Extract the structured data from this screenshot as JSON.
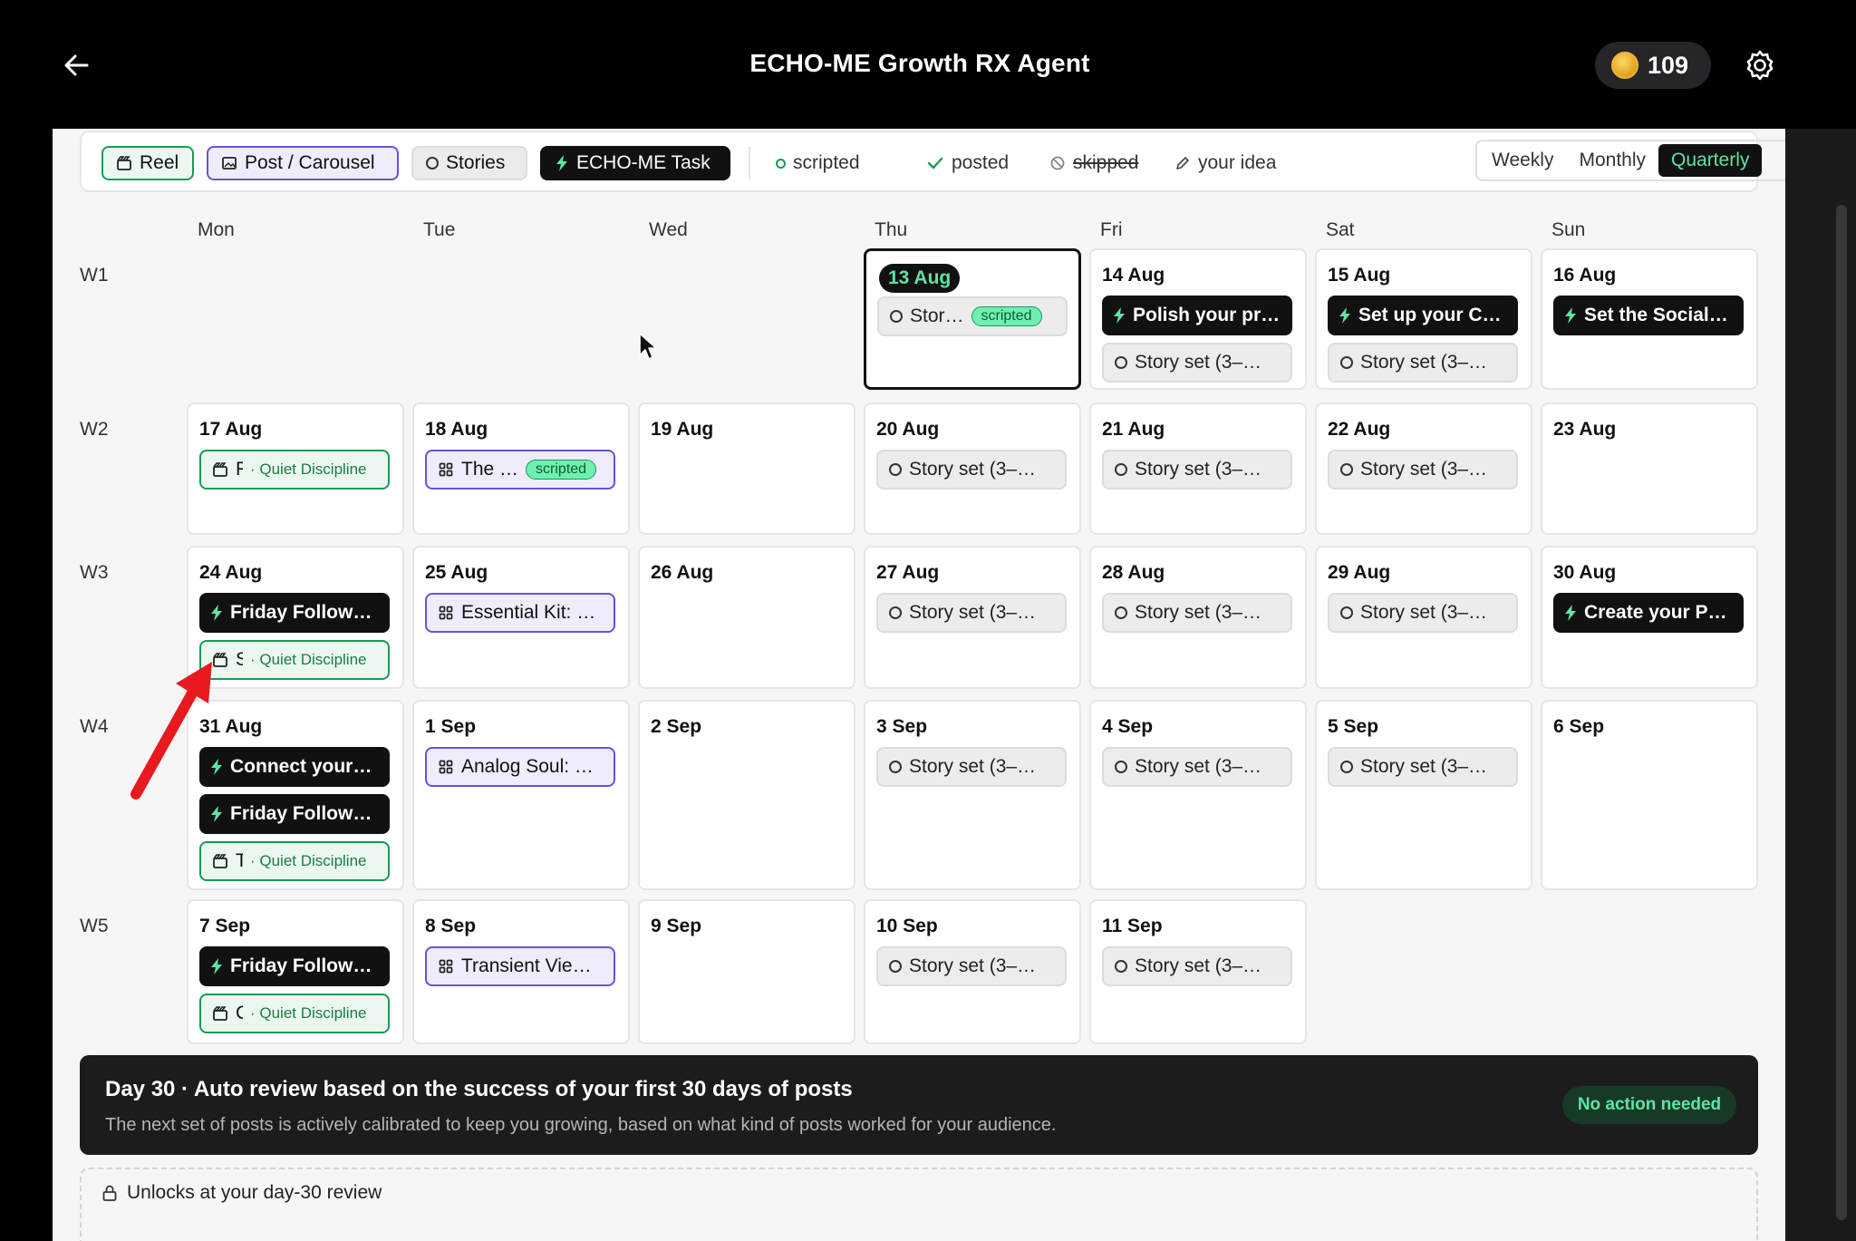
{
  "header": {
    "title": "ECHO-ME Growth RX Agent",
    "coins": "109"
  },
  "filters": {
    "reel": "Reel",
    "post": "Post / Carousel",
    "stories": "Stories",
    "task": "ECHO-ME Task"
  },
  "legend": {
    "scripted": "scripted",
    "posted": "posted",
    "skipped": "skipped",
    "idea": "your idea"
  },
  "views": {
    "weekly": "Weekly",
    "monthly": "Monthly",
    "quarterly": "Quarterly",
    "active": "Quarterly"
  },
  "colors": {
    "reel": "#1a9a57",
    "post": "#6a52d8",
    "task": "#111111",
    "accent": "#5fe3a1"
  },
  "days": [
    "Mon",
    "Tue",
    "Wed",
    "Thu",
    "Fri",
    "Sat",
    "Sun"
  ],
  "weeks": [
    {
      "label": "W1",
      "cells": [
        null,
        null,
        null,
        {
          "date": "13 Aug",
          "today": true,
          "events": [
            {
              "type": "story",
              "text": "Stor…",
              "badge": "scripted"
            }
          ]
        },
        {
          "date": "14 Aug",
          "events": [
            {
              "type": "task",
              "text": "Polish your pr…"
            },
            {
              "type": "story",
              "text": "Story set (3–…"
            }
          ]
        },
        {
          "date": "15 Aug",
          "events": [
            {
              "type": "task",
              "text": "Set up your C…"
            },
            {
              "type": "story",
              "text": "Story set (3–…"
            }
          ]
        },
        {
          "date": "16 Aug",
          "events": [
            {
              "type": "task",
              "text": "Set the Social…"
            }
          ]
        }
      ]
    },
    {
      "label": "W2",
      "cells": [
        {
          "date": "17 Aug",
          "events": [
            {
              "type": "reel",
              "text": "F",
              "tag": "· Quiet Discipline"
            }
          ]
        },
        {
          "date": "18 Aug",
          "events": [
            {
              "type": "post",
              "text": "The …",
              "badge": "scripted"
            }
          ]
        },
        {
          "date": "19 Aug",
          "events": []
        },
        {
          "date": "20 Aug",
          "events": [
            {
              "type": "story",
              "text": "Story set (3–…"
            }
          ]
        },
        {
          "date": "21 Aug",
          "events": [
            {
              "type": "story",
              "text": "Story set (3–…"
            }
          ]
        },
        {
          "date": "22 Aug",
          "events": [
            {
              "type": "story",
              "text": "Story set (3–…"
            }
          ]
        },
        {
          "date": "23 Aug",
          "events": []
        }
      ]
    },
    {
      "label": "W3",
      "cells": [
        {
          "date": "24 Aug",
          "events": [
            {
              "type": "task",
              "text": "Friday Follow…"
            },
            {
              "type": "reel",
              "text": "S",
              "tag": "· Quiet Discipline"
            }
          ]
        },
        {
          "date": "25 Aug",
          "events": [
            {
              "type": "post",
              "text": "Essential Kit: …"
            }
          ]
        },
        {
          "date": "26 Aug",
          "events": []
        },
        {
          "date": "27 Aug",
          "events": [
            {
              "type": "story",
              "text": "Story set (3–…"
            }
          ]
        },
        {
          "date": "28 Aug",
          "events": [
            {
              "type": "story",
              "text": "Story set (3–…"
            }
          ]
        },
        {
          "date": "29 Aug",
          "events": [
            {
              "type": "story",
              "text": "Story set (3–…"
            }
          ]
        },
        {
          "date": "30 Aug",
          "events": [
            {
              "type": "task",
              "text": "Create your P…"
            }
          ]
        }
      ]
    },
    {
      "label": "W4",
      "cells": [
        {
          "date": "31 Aug",
          "events": [
            {
              "type": "task",
              "text": "Connect your…"
            },
            {
              "type": "task",
              "text": "Friday Follow…"
            },
            {
              "type": "reel",
              "text": "T",
              "tag": "· Quiet Discipline"
            }
          ]
        },
        {
          "date": "1 Sep",
          "events": [
            {
              "type": "post",
              "text": "Analog Soul: …"
            }
          ]
        },
        {
          "date": "2 Sep",
          "events": []
        },
        {
          "date": "3 Sep",
          "events": [
            {
              "type": "story",
              "text": "Story set (3–…"
            }
          ]
        },
        {
          "date": "4 Sep",
          "events": [
            {
              "type": "story",
              "text": "Story set (3–…"
            }
          ]
        },
        {
          "date": "5 Sep",
          "events": [
            {
              "type": "story",
              "text": "Story set (3–…"
            }
          ]
        },
        {
          "date": "6 Sep",
          "events": []
        }
      ]
    },
    {
      "label": "W5",
      "cells": [
        {
          "date": "7 Sep",
          "events": [
            {
              "type": "task",
              "text": "Friday Follow…"
            },
            {
              "type": "reel",
              "text": "C",
              "tag": "· Quiet Discipline"
            }
          ]
        },
        {
          "date": "8 Sep",
          "events": [
            {
              "type": "post",
              "text": "Transient Vie…"
            }
          ]
        },
        {
          "date": "9 Sep",
          "events": []
        },
        {
          "date": "10 Sep",
          "events": [
            {
              "type": "story",
              "text": "Story set (3–…"
            }
          ]
        },
        {
          "date": "11 Sep",
          "events": [
            {
              "type": "story",
              "text": "Story set (3–…"
            }
          ]
        },
        null,
        null
      ]
    }
  ],
  "review": {
    "title": "Day 30 · Auto review based on the success of your first 30 days of posts",
    "subtitle": "The next set of posts is actively calibrated to keep you growing, based on what kind of posts worked for your audience.",
    "badge": "No action needed"
  },
  "unlock": {
    "text": "Unlocks at your day-30 review"
  }
}
